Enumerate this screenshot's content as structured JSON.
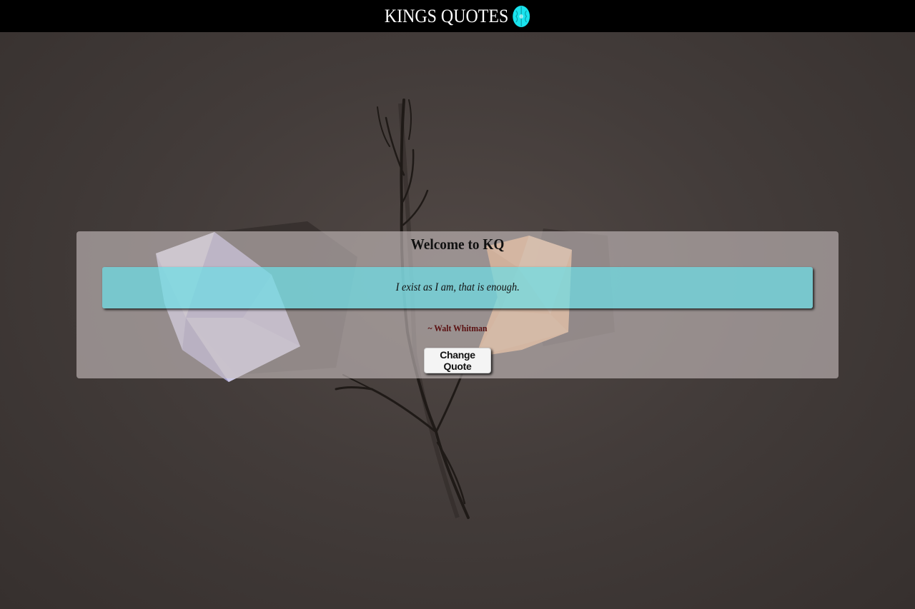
{
  "header": {
    "title": "KINGS QUOTES",
    "logo_icon": "brain-icon",
    "background_color": "#000000"
  },
  "card": {
    "title": "Welcome to KQ",
    "quote": "I exist as I am, that is enough.",
    "author": "~ Walt Whitman",
    "button_label": "Change Quote"
  },
  "colors": {
    "quote_box": "#6edee6",
    "author_text": "#5a0f10",
    "icon_accent": "#19e3ee"
  }
}
